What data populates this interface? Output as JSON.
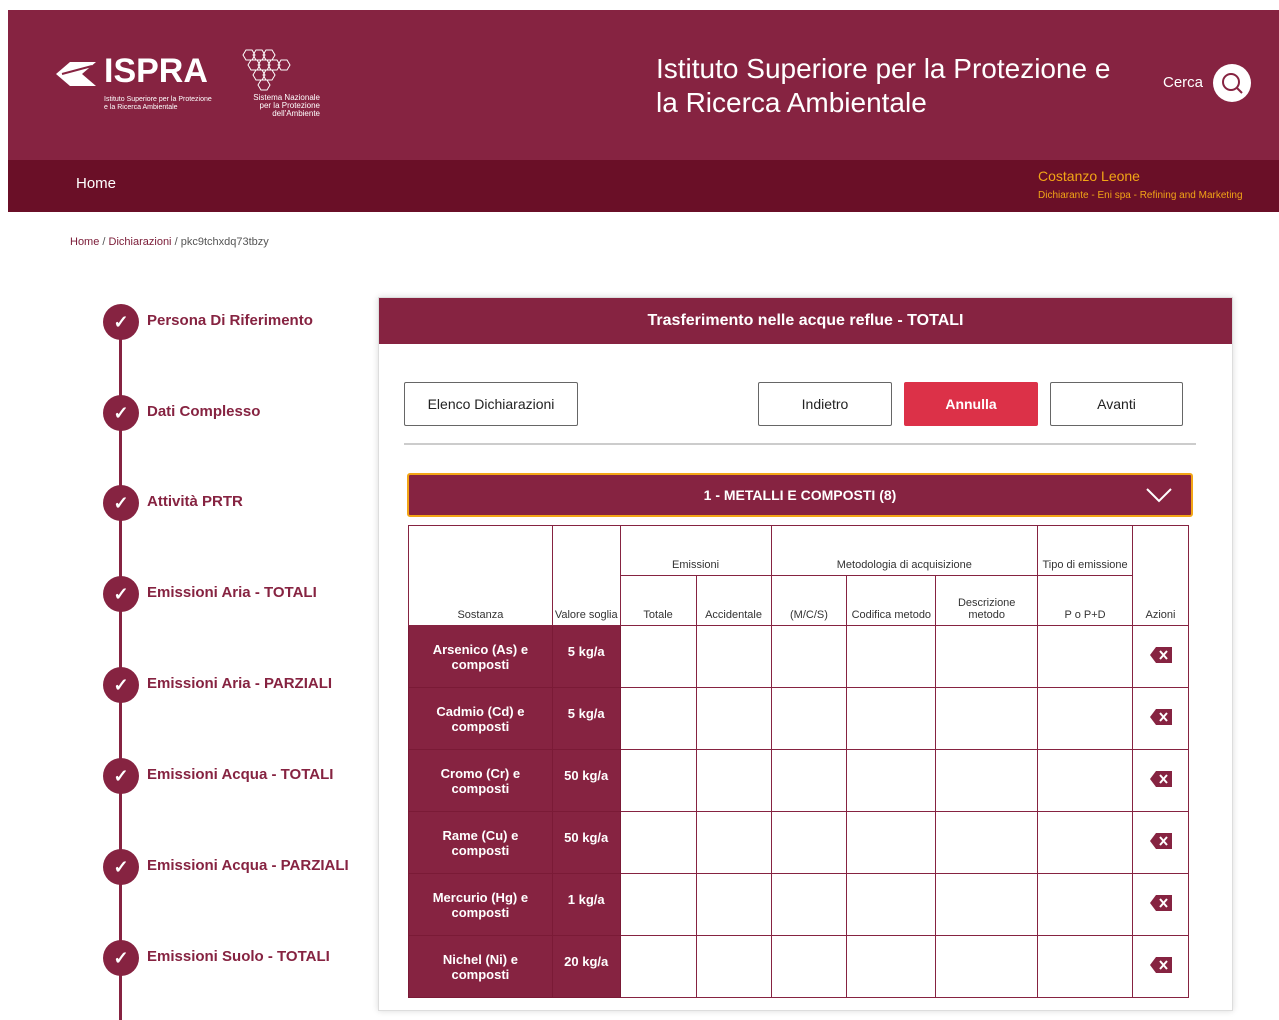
{
  "header": {
    "logo_text": "ISPRA",
    "logo_sub": "Istituto Superiore per la Protezione e la Ricerca Ambientale",
    "snpa_text": "Sistema Nazionale per la Protezione dell'Ambiente",
    "institute_title": "Istituto Superiore per la Protezione e la Ricerca Ambientale",
    "search_label": "Cerca"
  },
  "nav": {
    "home": "Home",
    "user_name": "Costanzo Leone",
    "user_role": "Dichiarante - Eni spa - Refining and Marketing"
  },
  "breadcrumb": {
    "home": "Home",
    "sep": "/",
    "dichiarazioni": "Dichiarazioni",
    "current": "pkc9tchxdq73tbzy"
  },
  "steps": [
    "Persona Di Riferimento",
    "Dati Complesso",
    "Attività PRTR",
    "Emissioni Aria - TOTALI",
    "Emissioni Aria - PARZIALI",
    "Emissioni Acqua - TOTALI",
    "Emissioni Acqua - PARZIALI",
    "Emissioni Suolo - TOTALI"
  ],
  "panel": {
    "title": "Trasferimento nelle acque reflue - TOTALI",
    "btn_elenco": "Elenco Dichiarazioni",
    "btn_indietro": "Indietro",
    "btn_annulla": "Annulla",
    "btn_avanti": "Avanti",
    "accordion_title": "1 - METALLI E COMPOSTI (8)"
  },
  "table": {
    "headers": {
      "sostanza": "Sostanza",
      "valore_soglia": "Valore soglia",
      "emissioni": "Emissioni",
      "totale": "Totale",
      "accidentale": "Accidentale",
      "metodologia": "Metodologia di acquisizione",
      "mcs": "(M/C/S)",
      "codifica": "Codifica metodo",
      "descrizione": "Descrizione metodo",
      "tipo": "Tipo di emissione",
      "popd": "P o P+D",
      "azioni": "Azioni"
    },
    "rows": [
      {
        "sostanza": "Arsenico (As) e composti",
        "soglia": "5 kg/a"
      },
      {
        "sostanza": "Cadmio (Cd) e composti",
        "soglia": "5 kg/a"
      },
      {
        "sostanza": "Cromo (Cr) e composti",
        "soglia": "50 kg/a"
      },
      {
        "sostanza": "Rame (Cu) e composti",
        "soglia": "50 kg/a"
      },
      {
        "sostanza": "Mercurio (Hg) e composti",
        "soglia": "1 kg/a"
      },
      {
        "sostanza": "Nichel (Ni) e composti",
        "soglia": "20 kg/a"
      }
    ]
  },
  "colors": {
    "brand": "#862341",
    "nav": "#6a0f27",
    "user": "#f2a516",
    "danger": "#dc3148"
  }
}
